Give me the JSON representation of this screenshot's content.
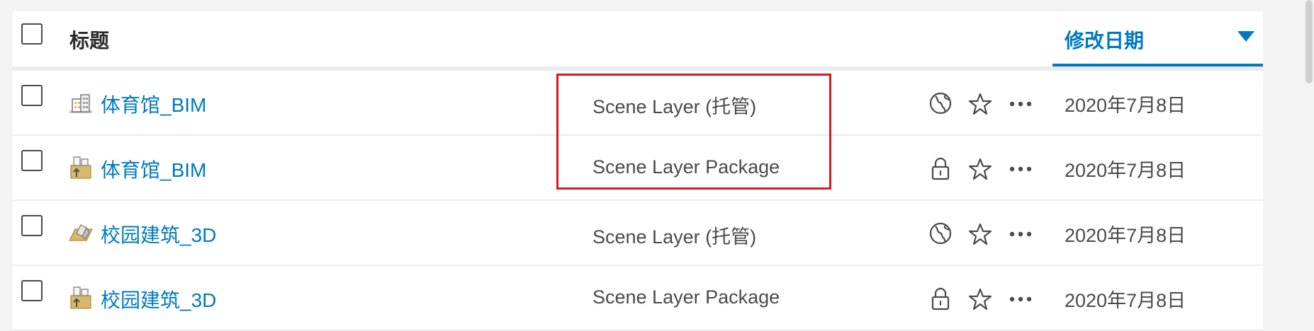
{
  "header": {
    "title_label": "标题",
    "date_label": "修改日期",
    "sort_icon": "sort-descending-icon"
  },
  "rows": [
    {
      "title": "体育馆_BIM",
      "type": "Scene Layer (托管)",
      "item_icon": "scene-layer-building-icon",
      "share_icon": "globe-icon",
      "date": "2020年7月8日"
    },
    {
      "title": "体育馆_BIM",
      "type": "Scene Layer Package",
      "item_icon": "scene-layer-package-icon",
      "share_icon": "lock-icon",
      "date": "2020年7月8日"
    },
    {
      "title": "校园建筑_3D",
      "type": "Scene Layer (托管)",
      "item_icon": "scene-layer-mesh-icon",
      "share_icon": "globe-icon",
      "date": "2020年7月8日"
    },
    {
      "title": "校园建筑_3D",
      "type": "Scene Layer Package",
      "item_icon": "scene-layer-package-icon",
      "share_icon": "lock-icon",
      "date": "2020年7月8日"
    }
  ],
  "colors": {
    "link": "#0079c1",
    "highlight": "#e0141e",
    "text": "#4a4a4a",
    "icon_tan": "#d9b86a"
  }
}
